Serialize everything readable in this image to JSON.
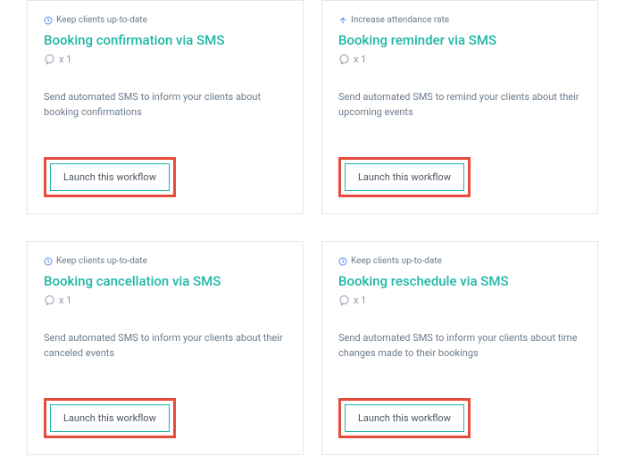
{
  "common": {
    "launch_label": "Launch this workflow",
    "count_prefix": "x 1"
  },
  "tags": {
    "keep_up_to_date": "Keep clients up-to-date",
    "increase_attendance": "Increase attendance rate"
  },
  "cards": [
    {
      "tag": "keep_up_to_date",
      "icon": "clock",
      "title": "Booking confirmation via SMS",
      "description": "Send automated SMS to inform your clients about booking confirmations"
    },
    {
      "tag": "increase_attendance",
      "icon": "arrow-up",
      "title": "Booking reminder via SMS",
      "description": "Send automated SMS to remind your clients about their upcoming events"
    },
    {
      "tag": "keep_up_to_date",
      "icon": "clock",
      "title": "Booking cancellation via SMS",
      "description": "Send automated SMS to inform your clients about their canceled events"
    },
    {
      "tag": "keep_up_to_date",
      "icon": "clock",
      "title": "Booking reschedule via SMS",
      "description": "Send automated SMS to inform your clients about time changes made to their bookings"
    }
  ]
}
